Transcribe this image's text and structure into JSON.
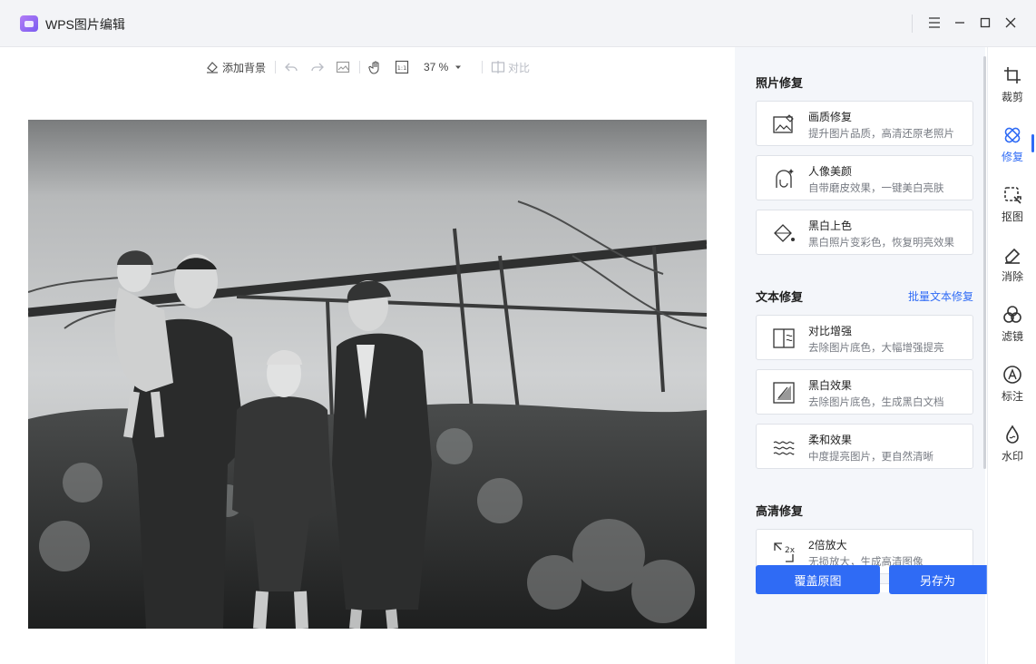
{
  "window": {
    "title": "WPS图片编辑"
  },
  "toolbar": {
    "add_background": "添加背景",
    "zoom": "37 %",
    "compare": "对比"
  },
  "panel": {
    "photo_repair": {
      "title": "照片修复",
      "items": [
        {
          "title": "画质修复",
          "desc": "提升图片品质，高清还原老照片",
          "icon": "image-enhance-icon"
        },
        {
          "title": "人像美颜",
          "desc": "自带磨皮效果，一键美白亮肤",
          "icon": "face-beauty-icon"
        },
        {
          "title": "黑白上色",
          "desc": "黑白照片变彩色，恢复明亮效果",
          "icon": "paint-bucket-icon"
        }
      ]
    },
    "text_repair": {
      "title": "文本修复",
      "link": "批量文本修复",
      "items": [
        {
          "title": "对比增强",
          "desc": "去除图片底色，大幅增强提亮",
          "icon": "contrast-icon"
        },
        {
          "title": "黑白效果",
          "desc": "去除图片底色，生成黑白文档",
          "icon": "bw-doc-icon"
        },
        {
          "title": "柔和效果",
          "desc": "中度提亮图片，更自然清晰",
          "icon": "soft-waves-icon"
        }
      ]
    },
    "hd_repair": {
      "title": "高清修复",
      "items": [
        {
          "title": "2倍放大",
          "desc": "无损放大，生成高清图像",
          "icon": "upscale-2x-icon"
        }
      ]
    },
    "buttons": {
      "overwrite": "覆盖原图",
      "save_as": "另存为"
    }
  },
  "rail": {
    "items": [
      {
        "label": "裁剪",
        "icon": "crop-icon"
      },
      {
        "label": "修复",
        "icon": "repair-icon",
        "active": true
      },
      {
        "label": "抠图",
        "icon": "cutout-icon"
      },
      {
        "label": "消除",
        "icon": "eraser-icon"
      },
      {
        "label": "滤镜",
        "icon": "filter-icon"
      },
      {
        "label": "标注",
        "icon": "annotate-icon"
      },
      {
        "label": "水印",
        "icon": "watermark-icon"
      }
    ]
  },
  "colors": {
    "accent": "#2f6bf5",
    "panel_bg": "#f4f6fa",
    "titlebar_bg": "#f3f4f7"
  }
}
